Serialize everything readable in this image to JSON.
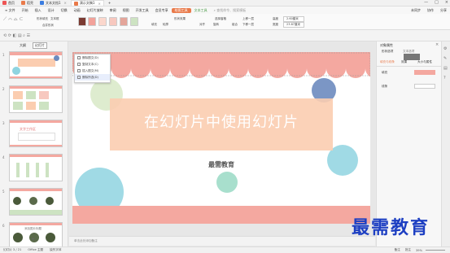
{
  "titlebar": {
    "tabs": [
      {
        "label": "首页",
        "icon": "home-icon",
        "color": "#e55"
      },
      {
        "label": "稻壳",
        "icon": "docer-icon",
        "color": "#e97a4a"
      },
      {
        "label": "文本文档1",
        "icon": "doc-icon",
        "color": "#3b7de0"
      },
      {
        "label": "演示文稿1",
        "icon": "ppt-icon",
        "color": "#e97a4a"
      }
    ],
    "window_controls": [
      "—",
      "□",
      "×"
    ]
  },
  "menubar": {
    "items": [
      "≡ 文件",
      "开始",
      "插入",
      "设计",
      "切换",
      "动画",
      "幻灯片放映",
      "审阅",
      "视图",
      "开发工具",
      "会员专享",
      "绘图工具",
      "文本工具"
    ],
    "search": "查找命令、搜索模板",
    "right_items": [
      "未同步",
      "协作",
      "分享"
    ]
  },
  "ribbon": {
    "shape_fill": "形状填充",
    "outline": "轮廓",
    "text_box": "文本框",
    "merge_shapes": "合并形状",
    "swatches": [
      "#7b3b32",
      "#f2a29a",
      "#f7c8bf",
      "#cde3c2"
    ],
    "fill": "填充",
    "outline2": "轮廓",
    "effect": "形状效果",
    "arrange": "对齐",
    "rotate": "旋转",
    "select_pane": "选择窗格",
    "group": "组合",
    "move_up": "上移一层",
    "move_down": "下移一层",
    "height_label": "高度",
    "height_value": "2.60厘米",
    "width_label": "宽度",
    "width_value": "23.87厘米"
  },
  "leftpanel": {
    "tab_outline": "大纲",
    "tab_slides": "幻灯片",
    "slide_numbers": [
      "1",
      "2",
      "3",
      "4",
      "5",
      "6"
    ],
    "slide3_title": "文字工作区",
    "slide6_title": "添加图片标题",
    "add_label": "+"
  },
  "slide": {
    "title": "在幻灯片中使用幻灯片",
    "subtitle": "最需教育",
    "colors": {
      "pink": "#f4a8a0",
      "peach": "#fbcdb0",
      "blue": "#8fd4e0",
      "green": "#c9e3b5",
      "navy": "#6d8bbf"
    }
  },
  "ctxmenu": {
    "items": [
      "删除图文(D)",
      "复制文本(C)",
      "插入图文(M)",
      "删除所选(D)"
    ]
  },
  "rightpanel": {
    "title": "对象属性",
    "tabs": [
      "形状选项",
      "文本选项"
    ],
    "subtabs": [
      "填充与线条",
      "效果",
      "大小与属性"
    ],
    "fill_label": "填充",
    "line_label": "线条"
  },
  "notes": {
    "placeholder": "单击此处添加备注"
  },
  "statusbar": {
    "slide_info": "幻灯片 3 / 21",
    "theme": "Office 主题",
    "missing_font": "缺失字体",
    "notes_btn": "备注",
    "comment_btn": "批注",
    "zoom": "39%"
  },
  "watermark": "最需教育"
}
